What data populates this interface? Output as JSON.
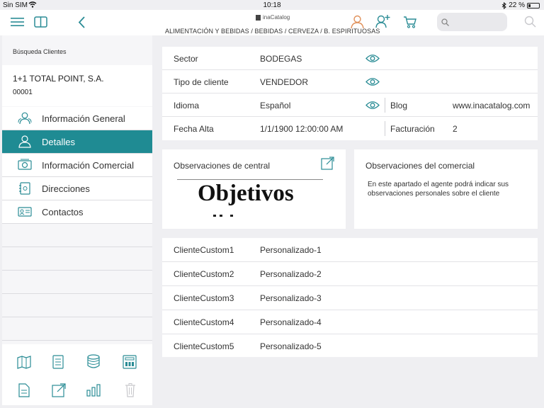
{
  "status_bar": {
    "carrier": "Sin SIM",
    "time": "10:18",
    "battery": "22 %",
    "battery_level": 0.22
  },
  "header": {
    "brand": "inaCatalog",
    "breadcrumb": "ALIMENTACIÓN Y BEBIDAS / BEBIDAS / CERVEZA / B. ESPIRITUOSAS",
    "icons": [
      "menu-icon",
      "split-view-icon",
      "back-icon",
      "user-icon",
      "add-user-icon",
      "cart-icon",
      "search-icon"
    ],
    "colors": {
      "accent": "#2a8c95",
      "user_icon": "#e0905a"
    }
  },
  "sidebar": {
    "title": "Búsqueda Clientes",
    "client_name": "1+1 TOTAL POINT, S.A.",
    "client_code": "00001",
    "items": [
      {
        "label": "Información General",
        "icon": "people-icon",
        "active": false
      },
      {
        "label": "Detalles",
        "icon": "person-icon",
        "active": true
      },
      {
        "label": "Información Comercial",
        "icon": "money-icon",
        "active": false
      },
      {
        "label": "Direcciones",
        "icon": "address-book-icon",
        "active": false
      },
      {
        "label": "Contactos",
        "icon": "contact-card-icon",
        "active": false
      }
    ],
    "tools": [
      "map-icon",
      "list-icon",
      "coins-icon",
      "calculator-icon",
      "document-icon",
      "share-icon",
      "chart-icon",
      "trash-icon"
    ]
  },
  "info": {
    "rows": [
      {
        "key": "Sector",
        "value": "BODEGAS"
      },
      {
        "key": "Tipo de cliente",
        "value": "VENDEDOR"
      },
      {
        "key": "Idioma",
        "value": "Español",
        "key2": "Blog",
        "value2": "www.inacatalog.com"
      },
      {
        "key": "Fecha Alta",
        "value": "1/1/1900 12:00:00 AM",
        "key2": "Facturación",
        "value2": "2"
      }
    ]
  },
  "obs_central": {
    "title": "Observaciones de central",
    "image_text": "Objetivos"
  },
  "obs_comercial": {
    "title": "Observaciones del comercial",
    "text": "En este apartado el agente podrá indicar sus observaciones personales sobre el cliente"
  },
  "custom": {
    "rows": [
      {
        "key": "ClienteCustom1",
        "value": "Personalizado-1"
      },
      {
        "key": "ClienteCustom2",
        "value": "Personalizado-2"
      },
      {
        "key": "ClienteCustom3",
        "value": "Personalizado-3"
      },
      {
        "key": "ClienteCustom4",
        "value": "Personalizado-4"
      },
      {
        "key": "ClienteCustom5",
        "value": "Personalizado-5"
      }
    ]
  }
}
